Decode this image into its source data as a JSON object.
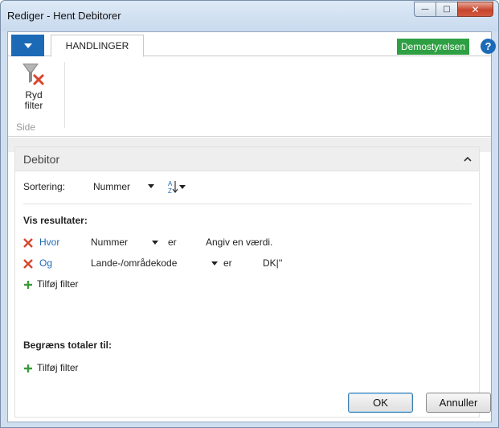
{
  "window": {
    "title": "Rediger - Hent Debitorer"
  },
  "ribbon": {
    "tab_label": "HANDLINGER",
    "company": "Demostyrelsen",
    "clear_filter_label_line1": "Ryd",
    "clear_filter_label_line2": "filter",
    "group_label": "Side"
  },
  "panel": {
    "title": "Debitor",
    "sort_label": "Sortering:",
    "sort_value": "Nummer",
    "show_results_title": "Vis resultater:",
    "filters": [
      {
        "connector": "Hvor",
        "field": "Nummer",
        "operator": "er",
        "value": "Angiv en værdi."
      },
      {
        "connector": "Og",
        "field": "Lande-/områdekode",
        "operator": "er",
        "value": "DK|''"
      }
    ],
    "add_filter_label": "Tilføj filter",
    "limit_totals_title": "Begræns totaler til:",
    "add_filter_label_2": "Tilføj filter"
  },
  "buttons": {
    "ok": "OK",
    "cancel": "Annuller"
  },
  "colors": {
    "accent_blue": "#1c6ab6",
    "company_green": "#2ea043",
    "remove_red": "#d9452b",
    "add_green": "#3a9a3a"
  }
}
